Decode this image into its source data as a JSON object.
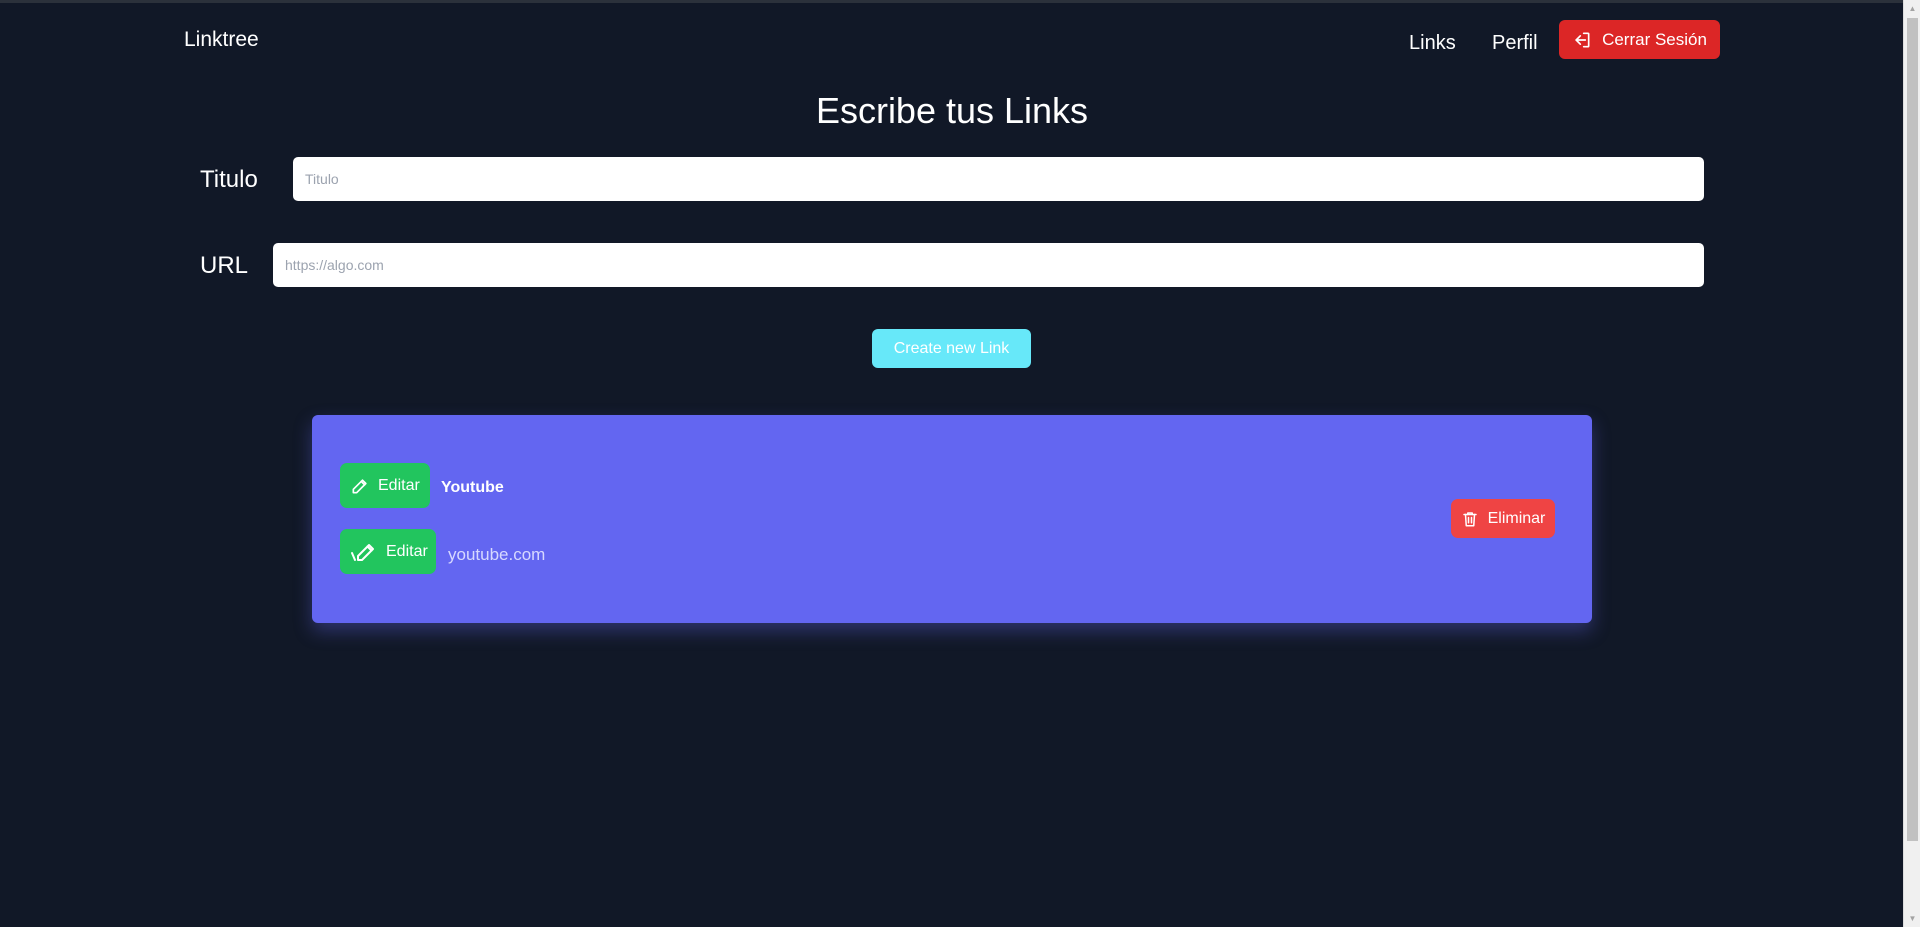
{
  "navbar": {
    "brand": "Linktree",
    "links_label": "Links",
    "perfil_label": "Perfil",
    "logout_label": "Cerrar Sesión"
  },
  "form": {
    "title": "Escribe tus Links",
    "titulo_label": "Titulo",
    "titulo_placeholder": "Titulo",
    "url_label": "URL",
    "url_placeholder": "https://algo.com",
    "create_label": "Create new Link"
  },
  "links": [
    {
      "title": "Youtube",
      "url": "youtube.com",
      "edit_label": "Editar",
      "delete_label": "Eliminar"
    }
  ],
  "colors": {
    "background": "#111827",
    "card": "#6366f1",
    "edit": "#22c55e",
    "delete": "#ef4444",
    "logout": "#dc2626",
    "create": "#67e8f9"
  },
  "icons": {
    "logout": "logout-icon",
    "edit": "pencil-icon",
    "delete": "trash-icon"
  }
}
